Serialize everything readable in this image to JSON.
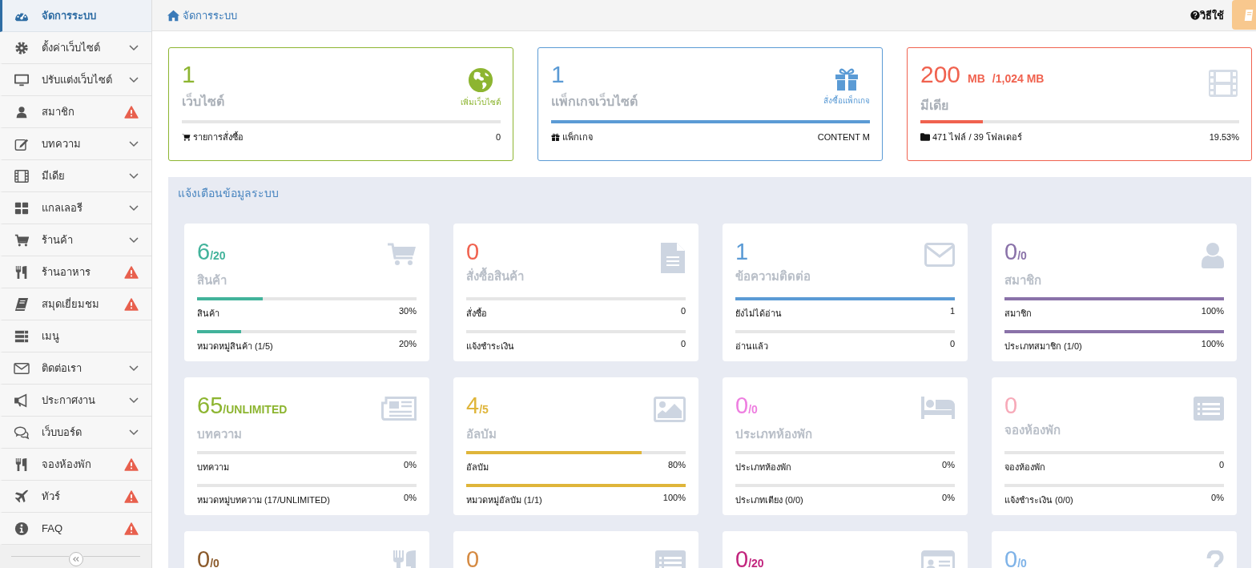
{
  "sidebar": {
    "items": [
      {
        "label": "จัดการระบบ",
        "selected": true,
        "expandable": false,
        "warning": false
      },
      {
        "label": "ตั้งค่าเว็บไซต์",
        "selected": false,
        "expandable": true,
        "warning": false
      },
      {
        "label": "ปรับแต่งเว็บไซต์",
        "selected": false,
        "expandable": true,
        "warning": false
      },
      {
        "label": "สมาชิก",
        "selected": false,
        "expandable": false,
        "warning": true
      },
      {
        "label": "บทความ",
        "selected": false,
        "expandable": true,
        "warning": false
      },
      {
        "label": "มีเดีย",
        "selected": false,
        "expandable": true,
        "warning": false
      },
      {
        "label": "แกลเลอรี",
        "selected": false,
        "expandable": true,
        "warning": false
      },
      {
        "label": "ร้านค้า",
        "selected": false,
        "expandable": true,
        "warning": false
      },
      {
        "label": "ร้านอาหาร",
        "selected": false,
        "expandable": false,
        "warning": true
      },
      {
        "label": "สมุดเยี่ยมชม",
        "selected": false,
        "expandable": false,
        "warning": true
      },
      {
        "label": "เมนู",
        "selected": false,
        "expandable": false,
        "warning": false
      },
      {
        "label": "ติดต่อเรา",
        "selected": false,
        "expandable": true,
        "warning": false
      },
      {
        "label": "ประกาศงาน",
        "selected": false,
        "expandable": true,
        "warning": false
      },
      {
        "label": "เว็บบอร์ด",
        "selected": false,
        "expandable": true,
        "warning": false
      },
      {
        "label": "จองห้องพัก",
        "selected": false,
        "expandable": false,
        "warning": true
      },
      {
        "label": "ทัวร์",
        "selected": false,
        "expandable": false,
        "warning": true
      },
      {
        "label": "FAQ",
        "selected": false,
        "expandable": false,
        "warning": true
      }
    ]
  },
  "header": {
    "breadcrumb": "จัดการระบบ",
    "help": "วิธีใช้"
  },
  "summary_cards": [
    {
      "value": "1",
      "label": "เว็บไซต์",
      "link": "เพิ่มเว็บไซต์",
      "footer_label": "รายการสั่งซื้อ",
      "footer_value": "0",
      "level": 0,
      "color": "#8db531"
    },
    {
      "value": "1",
      "label": "แพ็กเกจเว็บไซต์",
      "link": "สั่งซื้อแพ็กเกจ",
      "footer_label": "แพ็กเกจ",
      "footer_value": "CONTENT M",
      "level": 1,
      "color": "#5b9bd5"
    },
    {
      "value": "200",
      "unit": "MB",
      "limit": "/1,024 MB",
      "label": "มีเดีย",
      "footer_label": "471 ไฟล์ / 39 โฟลเดอร์",
      "footer_value": "19.53%",
      "level": 0.1953,
      "color": "#f0624f"
    }
  ],
  "alerts": {
    "title": "แจ้งเตือนข้อมูลระบบ",
    "cards": [
      {
        "value": "6",
        "suffix": "/20",
        "label": "สินค้า",
        "color": "#42b39b",
        "rows": [
          {
            "label": "สินค้า",
            "value": "30%",
            "level": 0.3
          },
          {
            "label": "หมวดหมู่สินค้า (1/5)",
            "value": "20%",
            "level": 0.2
          }
        ]
      },
      {
        "value": "0",
        "label": "สั่งซื้อสินค้า",
        "color": "#f0624f",
        "rows": [
          {
            "label": "สั่งซื้อ",
            "value": "0",
            "level": 0
          },
          {
            "label": "แจ้งชำระเงิน",
            "value": "0",
            "level": 0
          }
        ]
      },
      {
        "value": "1",
        "label": "ข้อความติดต่อ",
        "color": "#5b9bd5",
        "rows": [
          {
            "label": "ยังไม่ได้อ่าน",
            "value": "1",
            "level": 1
          },
          {
            "label": "อ่านแล้ว",
            "value": "0",
            "level": 0
          }
        ]
      },
      {
        "value": "0",
        "suffix": "/0",
        "label": "สมาชิก",
        "color": "#8a72a9",
        "rows": [
          {
            "label": "สมาชิก",
            "value": "100%",
            "level": 1
          },
          {
            "label": "ประเภทสมาชิก (1/0)",
            "value": "100%",
            "level": 1
          }
        ]
      },
      {
        "value": "65",
        "suffix": "/UNLIMITED",
        "label": "บทความ",
        "color": "#8db531",
        "rows": [
          {
            "label": "บทความ",
            "value": "0%",
            "level": 0
          },
          {
            "label": "หมวดหมู่บทความ (17/UNLIMITED)",
            "value": "0%",
            "level": 0
          }
        ]
      },
      {
        "value": "4",
        "suffix": "/5",
        "label": "อัลบัม",
        "color": "#dfb53a",
        "rows": [
          {
            "label": "อัลบัม",
            "value": "80%",
            "level": 0.8
          },
          {
            "label": "หมวดหมู่อัลบัม (1/1)",
            "value": "100%",
            "level": 1
          }
        ]
      },
      {
        "value": "0",
        "suffix": "/0",
        "label": "ประเภทห้องพัก",
        "color": "#ee7ee0",
        "rows": [
          {
            "label": "ประเภทห้องพัก",
            "value": "0%",
            "level": 0
          },
          {
            "label": "ประเภทเตียง (0/0)",
            "value": "0%",
            "level": 0
          }
        ]
      },
      {
        "value": "0",
        "label": "จองห้องพัก",
        "color": "#f7a9b8",
        "rows": [
          {
            "label": "จองห้องพัก",
            "value": "0",
            "level": 0
          },
          {
            "label": "แจ้งชำระเงิน (0/0)",
            "value": "0%",
            "level": 0
          }
        ]
      },
      {
        "value": "0",
        "suffix": "/0",
        "color": "#8b5a2b"
      },
      {
        "value": "0",
        "color": "#d58a42"
      },
      {
        "value": "0",
        "suffix": "/20",
        "color": "#c2247d"
      },
      {
        "value": "0",
        "suffix": "/0",
        "color": "#7fb3e8"
      }
    ]
  }
}
